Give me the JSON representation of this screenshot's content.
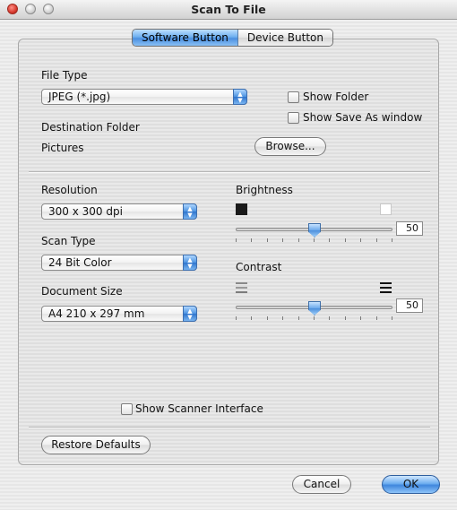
{
  "window": {
    "title": "Scan To File"
  },
  "tabs": [
    {
      "label": "Software Button",
      "active": true
    },
    {
      "label": "Device Button",
      "active": false
    }
  ],
  "file_type": {
    "label": "File Type",
    "value": "JPEG (*.jpg)"
  },
  "options": {
    "show_folder": "Show Folder",
    "show_save_as": "Show Save As window"
  },
  "destination": {
    "label": "Destination Folder",
    "value": "Pictures",
    "browse_label": "Browse..."
  },
  "resolution": {
    "label": "Resolution",
    "value": "300 x 300 dpi"
  },
  "scan_type": {
    "label": "Scan Type",
    "value": "24 Bit Color"
  },
  "document_size": {
    "label": "Document Size",
    "value": "A4  210 x 297 mm"
  },
  "brightness": {
    "label": "Brightness",
    "value": "50",
    "level": 50,
    "min_icon": "dark-square-icon",
    "max_icon": "light-square-icon"
  },
  "contrast": {
    "label": "Contrast",
    "value": "50",
    "level": 50,
    "min_icon": "low-contrast-icon",
    "max_icon": "high-contrast-icon"
  },
  "show_scanner_interface": "Show Scanner Interface",
  "restore_defaults": "Restore Defaults",
  "buttons": {
    "cancel": "Cancel",
    "ok": "OK"
  },
  "colors": {
    "accent": "#4b8fe0",
    "window_bg": "#ececec"
  }
}
